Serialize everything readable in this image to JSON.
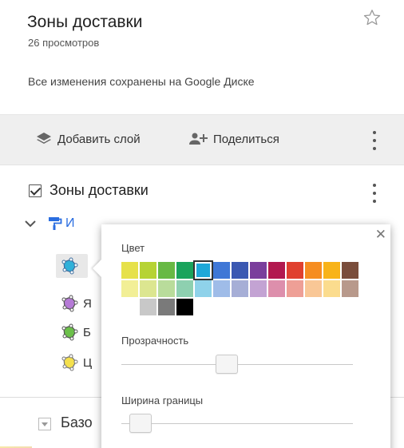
{
  "map": {
    "title": "Зоны доставки",
    "views": "26 просмотров",
    "saved_status": "Все изменения сохранены на Google Диске"
  },
  "toolbar": {
    "add_layer_label": "Добавить слой",
    "share_label": "Поделиться"
  },
  "layer": {
    "name": "Зоны доставки",
    "style_link": "И"
  },
  "features": [
    {
      "label": "",
      "color": "#2fb1d9",
      "active": true
    },
    {
      "label": "Я",
      "color": "#b57ad6"
    },
    {
      "label": "Б",
      "color": "#6cc04a"
    },
    {
      "label": "Ц",
      "color": "#f4e04d"
    }
  ],
  "base_layer": {
    "label": "Базо"
  },
  "style_popup": {
    "color_label": "Цвет",
    "opacity_label": "Прозрачность",
    "opacity_value": 0.45,
    "border_width_label": "Ширина границы",
    "border_width_value": 0.04,
    "selected_color": "#1fa8d8",
    "palette_rows": [
      [
        "#e6e14a",
        "#b6d334",
        "#68b944",
        "#1aa35c",
        "#1fa8d8",
        "#3f77d6",
        "#3b58b2",
        "#7a3e9c",
        "#b2194f",
        "#e0402f",
        "#f68d21",
        "#f8b319",
        "#7a4d3b"
      ],
      [
        "#f2ef96",
        "#dce690",
        "#b9dc9b",
        "#8ed0b0",
        "#8fd2ea",
        "#9fbce8",
        "#a6aed6",
        "#c3a3d3",
        "#dd8fac",
        "#ee9f96",
        "#f9c796",
        "#fbdc8e",
        "#b8998b"
      ],
      [
        "",
        "#c8c8c8",
        "#7a7a7a",
        "#000000"
      ]
    ]
  }
}
